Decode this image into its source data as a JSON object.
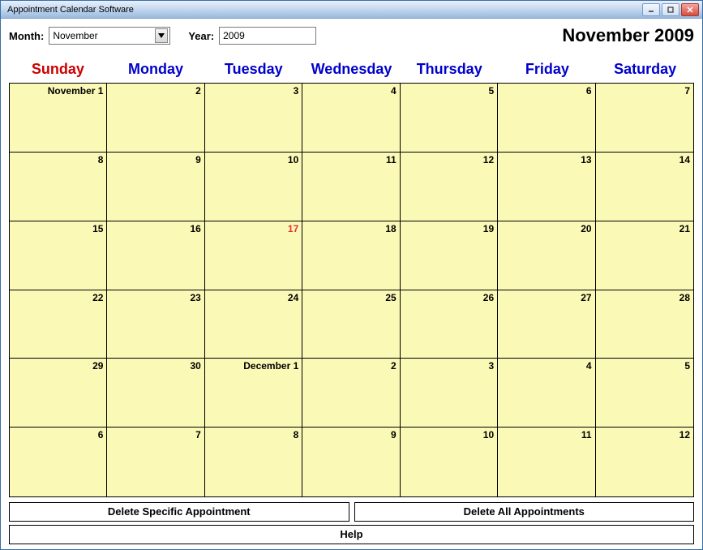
{
  "window": {
    "title": "Appointment Calendar Software"
  },
  "controls": {
    "month_label": "Month:",
    "month_value": "November",
    "year_label": "Year:",
    "year_value": "2009"
  },
  "header_title": "November 2009",
  "day_headers": [
    "Sunday",
    "Monday",
    "Tuesday",
    "Wednesday",
    "Thursday",
    "Friday",
    "Saturday"
  ],
  "cells": [
    {
      "label": "November 1",
      "today": false
    },
    {
      "label": "2",
      "today": false
    },
    {
      "label": "3",
      "today": false
    },
    {
      "label": "4",
      "today": false
    },
    {
      "label": "5",
      "today": false
    },
    {
      "label": "6",
      "today": false
    },
    {
      "label": "7",
      "today": false
    },
    {
      "label": "8",
      "today": false
    },
    {
      "label": "9",
      "today": false
    },
    {
      "label": "10",
      "today": false
    },
    {
      "label": "11",
      "today": false
    },
    {
      "label": "12",
      "today": false
    },
    {
      "label": "13",
      "today": false
    },
    {
      "label": "14",
      "today": false
    },
    {
      "label": "15",
      "today": false
    },
    {
      "label": "16",
      "today": false
    },
    {
      "label": "17",
      "today": true
    },
    {
      "label": "18",
      "today": false
    },
    {
      "label": "19",
      "today": false
    },
    {
      "label": "20",
      "today": false
    },
    {
      "label": "21",
      "today": false
    },
    {
      "label": "22",
      "today": false
    },
    {
      "label": "23",
      "today": false
    },
    {
      "label": "24",
      "today": false
    },
    {
      "label": "25",
      "today": false
    },
    {
      "label": "26",
      "today": false
    },
    {
      "label": "27",
      "today": false
    },
    {
      "label": "28",
      "today": false
    },
    {
      "label": "29",
      "today": false
    },
    {
      "label": "30",
      "today": false
    },
    {
      "label": "December 1",
      "today": false
    },
    {
      "label": "2",
      "today": false
    },
    {
      "label": "3",
      "today": false
    },
    {
      "label": "4",
      "today": false
    },
    {
      "label": "5",
      "today": false
    },
    {
      "label": "6",
      "today": false
    },
    {
      "label": "7",
      "today": false
    },
    {
      "label": "8",
      "today": false
    },
    {
      "label": "9",
      "today": false
    },
    {
      "label": "10",
      "today": false
    },
    {
      "label": "11",
      "today": false
    },
    {
      "label": "12",
      "today": false
    }
  ],
  "buttons": {
    "delete_specific": "Delete Specific Appointment",
    "delete_all": "Delete All Appointments",
    "help": "Help"
  }
}
